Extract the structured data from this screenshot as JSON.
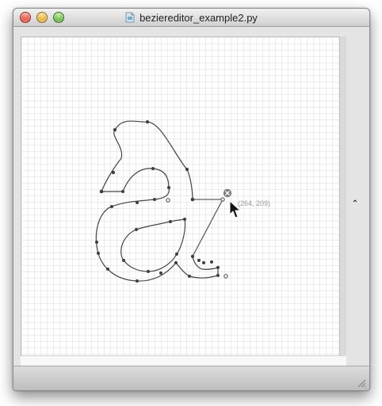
{
  "window": {
    "title": "beziereditor_example2.py",
    "title_icon": "python-file-icon",
    "buttons": [
      "close",
      "minimize",
      "zoom"
    ]
  },
  "canvas": {
    "grid": true,
    "grid_color": "#e5e5e5",
    "curve_color": "#444444",
    "handle_line_color": "#666666",
    "cursor_readout": "(264, 209)"
  },
  "icons": {
    "cursor": "arrow-cursor-icon",
    "delete_handle": "delete-handle-icon",
    "resize": "resize-grip-icon",
    "splitter": "splitter-handle-icon"
  }
}
